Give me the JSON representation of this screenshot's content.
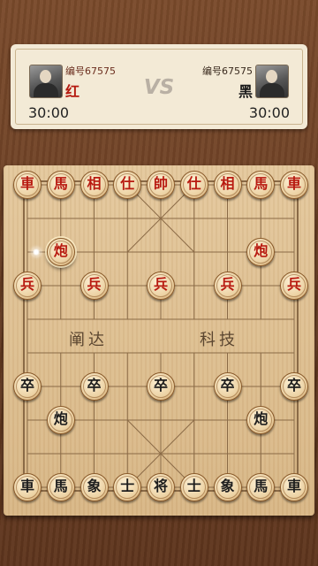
{
  "players": {
    "red": {
      "id_label": "编号67575",
      "side": "红",
      "time": "30:00"
    },
    "black": {
      "id_label": "编号67575",
      "side": "黑",
      "time": "30:00"
    },
    "vs": "VS"
  },
  "board": {
    "river_left": "阐达",
    "river_right": "科技",
    "pieces": [
      {
        "char": "車",
        "color": "red",
        "col": 0,
        "row": 0
      },
      {
        "char": "馬",
        "color": "red",
        "col": 1,
        "row": 0
      },
      {
        "char": "相",
        "color": "red",
        "col": 2,
        "row": 0
      },
      {
        "char": "仕",
        "color": "red",
        "col": 3,
        "row": 0
      },
      {
        "char": "帥",
        "color": "red",
        "col": 4,
        "row": 0
      },
      {
        "char": "仕",
        "color": "red",
        "col": 5,
        "row": 0
      },
      {
        "char": "相",
        "color": "red",
        "col": 6,
        "row": 0
      },
      {
        "char": "馬",
        "color": "red",
        "col": 7,
        "row": 0
      },
      {
        "char": "車",
        "color": "red",
        "col": 8,
        "row": 0
      },
      {
        "char": "炮",
        "color": "red",
        "col": 1,
        "row": 2,
        "selected": true
      },
      {
        "char": "炮",
        "color": "red",
        "col": 7,
        "row": 2
      },
      {
        "char": "兵",
        "color": "red",
        "col": 0,
        "row": 3
      },
      {
        "char": "兵",
        "color": "red",
        "col": 2,
        "row": 3
      },
      {
        "char": "兵",
        "color": "red",
        "col": 4,
        "row": 3
      },
      {
        "char": "兵",
        "color": "red",
        "col": 6,
        "row": 3
      },
      {
        "char": "兵",
        "color": "red",
        "col": 8,
        "row": 3
      },
      {
        "char": "卒",
        "color": "black",
        "col": 0,
        "row": 6
      },
      {
        "char": "卒",
        "color": "black",
        "col": 2,
        "row": 6
      },
      {
        "char": "卒",
        "color": "black",
        "col": 4,
        "row": 6
      },
      {
        "char": "卒",
        "color": "black",
        "col": 6,
        "row": 6
      },
      {
        "char": "卒",
        "color": "black",
        "col": 8,
        "row": 6
      },
      {
        "char": "炮",
        "color": "black",
        "col": 1,
        "row": 7
      },
      {
        "char": "炮",
        "color": "black",
        "col": 7,
        "row": 7
      },
      {
        "char": "車",
        "color": "black",
        "col": 0,
        "row": 9
      },
      {
        "char": "馬",
        "color": "black",
        "col": 1,
        "row": 9
      },
      {
        "char": "象",
        "color": "black",
        "col": 2,
        "row": 9
      },
      {
        "char": "士",
        "color": "black",
        "col": 3,
        "row": 9
      },
      {
        "char": "将",
        "color": "black",
        "col": 4,
        "row": 9
      },
      {
        "char": "士",
        "color": "black",
        "col": 5,
        "row": 9
      },
      {
        "char": "象",
        "color": "black",
        "col": 6,
        "row": 9
      },
      {
        "char": "馬",
        "color": "black",
        "col": 7,
        "row": 9
      },
      {
        "char": "車",
        "color": "black",
        "col": 8,
        "row": 9
      }
    ],
    "move_marker": {
      "col": 1,
      "row": 2
    }
  }
}
